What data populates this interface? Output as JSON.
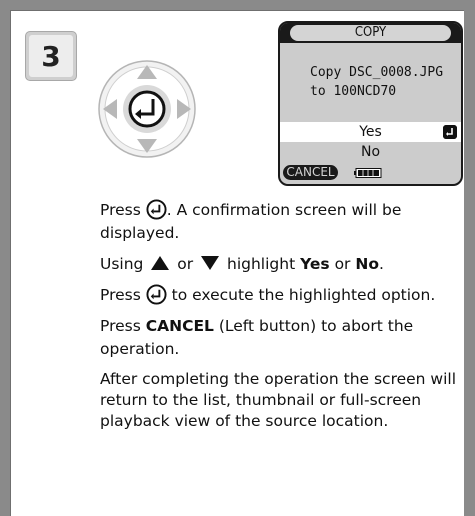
{
  "step": {
    "number": "3"
  },
  "screen": {
    "title": "COPY",
    "message_line1": "Copy DSC_0008.JPG",
    "message_line2": "to 100NCD70",
    "option_yes": "Yes",
    "option_no": "No",
    "cancel_label": "CANCEL"
  },
  "instructions": {
    "p1_a": "Press",
    "p1_b": ". A confirmation screen will be displayed.",
    "p2_a": "Using",
    "p2_b": "or",
    "p2_c": "highlight",
    "p2_yes": "Yes",
    "p2_d": "or",
    "p2_no": "No",
    "p2_e": ".",
    "p3_a": "Press",
    "p3_b": "to execute the highlighted option.",
    "p4_cancel": "CANCEL",
    "p4_rest": "(Left button) to abort the operation.",
    "p4_press": "Press",
    "p5": "After completing the operation the screen will return to the list, thumbnail or full-screen playback view of the source location."
  },
  "colors": {
    "page_bg": "#8a8a8a",
    "panel_bg": "#ffffff",
    "screen_bg": "#cccccc",
    "screen_dark": "#1a1a1a"
  },
  "icons": [
    "enter-button-icon",
    "up-arrow-icon",
    "down-arrow-icon",
    "multi-selector-icon",
    "battery-icon"
  ]
}
